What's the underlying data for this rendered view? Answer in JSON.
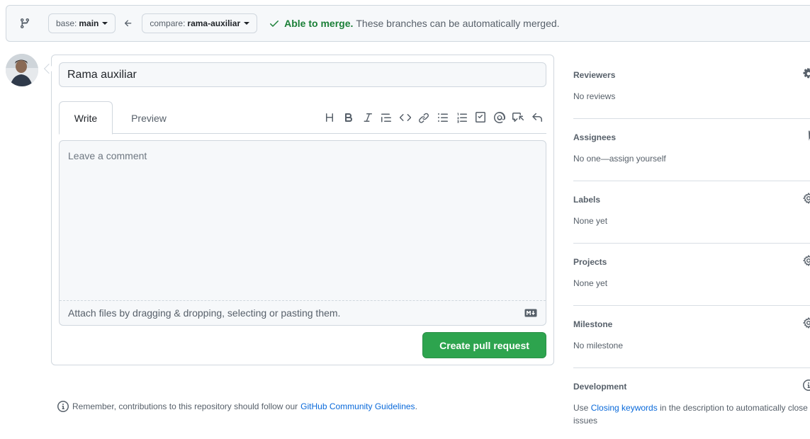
{
  "compare": {
    "base_label": "base:",
    "base_branch": "main",
    "compare_label": "compare:",
    "compare_branch": "rama-auxiliar",
    "status_ok": "Able to merge.",
    "status_desc": "These branches can be automatically merged."
  },
  "composer": {
    "title_value": "Rama auxiliar",
    "tab_write": "Write",
    "tab_preview": "Preview",
    "comment_placeholder": "Leave a comment",
    "attach_text": "Attach files by dragging & dropping, selecting or pasting them.",
    "create_button": "Create pull request",
    "toolbar_icons": [
      "heading-icon",
      "bold-icon",
      "italic-icon",
      "quote-icon",
      "code-icon",
      "link-icon",
      "unordered-list-icon",
      "ordered-list-icon",
      "task-list-icon",
      "mention-icon",
      "reference-icon",
      "undo-icon"
    ]
  },
  "guideline": {
    "text": "Remember, contributions to this repository should follow our",
    "link": "GitHub Community Guidelines",
    "end": "."
  },
  "sidebar": {
    "reviewers": {
      "title": "Reviewers",
      "value": "No reviews"
    },
    "assignees": {
      "title": "Assignees",
      "value": "No one—assign yourself"
    },
    "labels": {
      "title": "Labels",
      "value": "None yet"
    },
    "projects": {
      "title": "Projects",
      "value": "None yet"
    },
    "milestone": {
      "title": "Milestone",
      "value": "No milestone"
    },
    "development": {
      "title": "Development",
      "pre": "Use",
      "link": "Closing keywords",
      "post": "in the description to automatically close issues"
    }
  },
  "colors": {
    "accent_green": "#2da44e",
    "link_blue": "#0969da",
    "ok_green": "#1a7f37"
  }
}
